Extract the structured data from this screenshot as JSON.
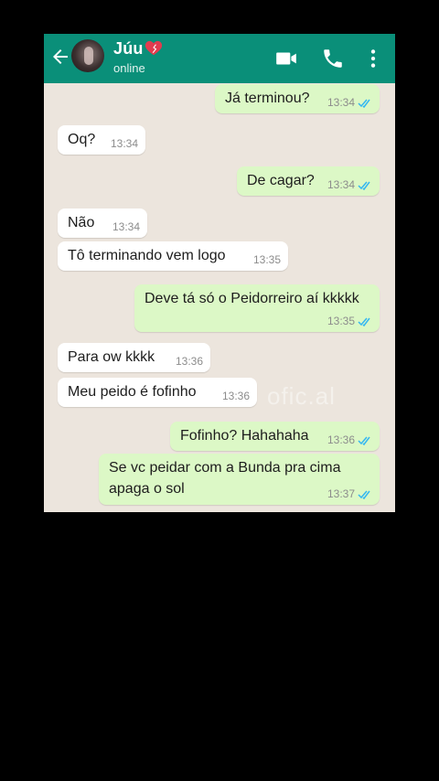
{
  "header": {
    "contact_name": "Júu",
    "status": "online"
  },
  "icons": {
    "back": "arrow-left-icon",
    "video": "video-call-icon",
    "call": "phone-icon",
    "menu": "more-vert-icon",
    "name_heart": "heart-icon",
    "read_receipt": "double-check-icon"
  },
  "colors": {
    "header": "#0a8f79",
    "chat_background": "#ece5dd",
    "incoming_bubble": "#ffffff",
    "outgoing_bubble": "#dcf8c6",
    "read_tick": "#34b7f1",
    "heart": "#e23b4f"
  },
  "watermark": "ofic.al",
  "messages": [
    {
      "dir": "out",
      "text": "Já terminou?",
      "time": "13:34",
      "read": true
    },
    {
      "dir": "in",
      "text": "Oq?",
      "time": "13:34"
    },
    {
      "dir": "out",
      "text": "De cagar?",
      "time": "13:34",
      "read": true
    },
    {
      "dir": "in",
      "text": "Não",
      "time": "13:34"
    },
    {
      "dir": "in",
      "text": "Tô terminando vem logo",
      "time": "13:35"
    },
    {
      "dir": "out",
      "text": "Deve tá só o Peidorreiro aí kkkkk",
      "time": "13:35",
      "read": true
    },
    {
      "dir": "in",
      "text": "Para ow kkkk",
      "time": "13:36"
    },
    {
      "dir": "in",
      "text": "Meu peido é fofinho",
      "time": "13:36"
    },
    {
      "dir": "out",
      "text": "Fofinho? Hahahaha",
      "time": "13:36",
      "read": true
    },
    {
      "dir": "out",
      "text": "Se vc peidar com a Bunda pra cima",
      "text2": "apaga o sol",
      "time": "13:37",
      "read": true
    }
  ]
}
